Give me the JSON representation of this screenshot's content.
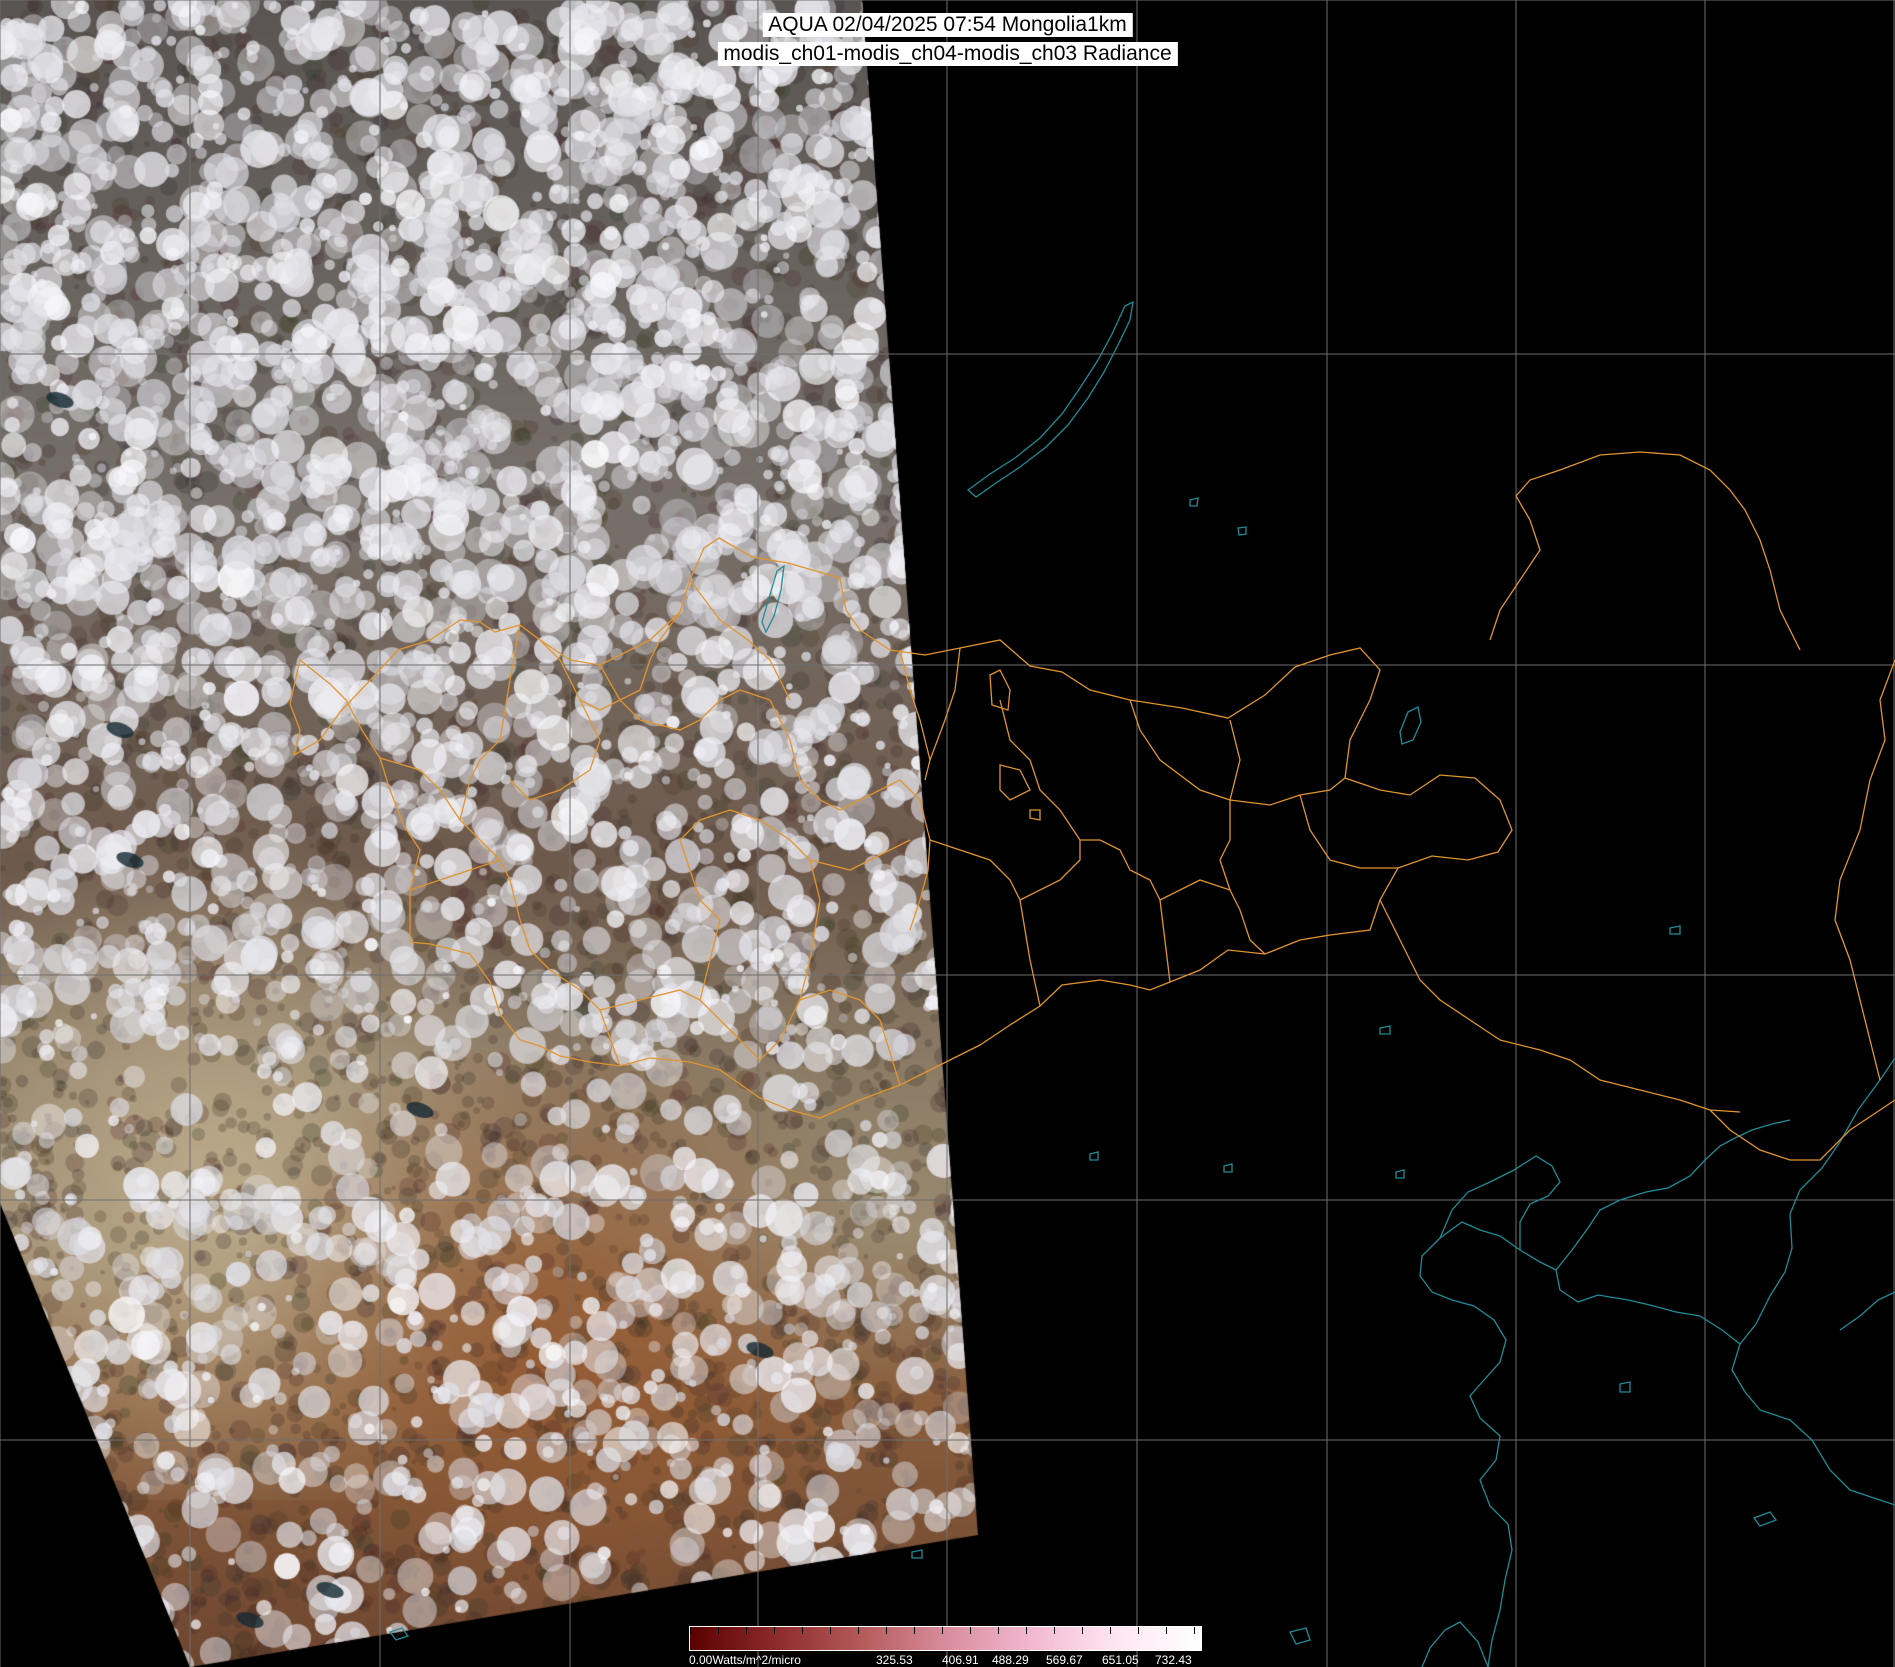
{
  "title": {
    "line1": "AQUA 02/04/2025 07:54 Mongolia1km",
    "line2": "modis_ch01-modis_ch04-modis_ch03 Radiance"
  },
  "colorbar": {
    "unit_label": "0.00Watts/m^2/micro",
    "tick_labels": [
      "325.53",
      "406.91",
      "488.29",
      "569.67",
      "651.05",
      "732.43"
    ],
    "colors": [
      "#5a0000",
      "#8c2a2a",
      "#b45a5a",
      "#d88c9c",
      "#f2b8d0",
      "#ffe6f2",
      "#ffffff"
    ]
  },
  "map": {
    "satellite": "AQUA",
    "date": "02/04/2025",
    "time": "07:54",
    "region": "Mongolia1km",
    "product": "modis_ch01-modis_ch04-modis_ch03 Radiance",
    "graticule_color": "#6e6e6e",
    "border_color": "#e0952f",
    "coastline_color": "#1f8c98",
    "no_data_color": "#000000"
  }
}
